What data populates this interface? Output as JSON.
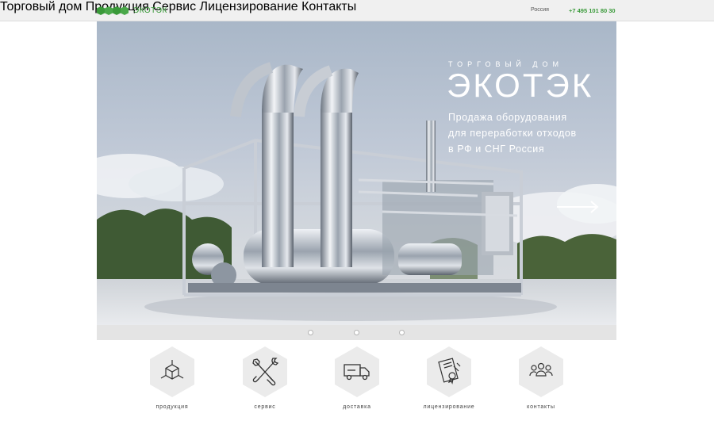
{
  "header": {
    "brand": "ЭКОТЭК",
    "nav": [
      "Торговый дом",
      "Продукция",
      "Сервис",
      "Лицензирование",
      "Контакты"
    ],
    "region": "Россия",
    "phone": "+7 495 101 80 30"
  },
  "hero": {
    "subtitle": "ТОРГОВЫЙ ДОМ",
    "title": "ЭКОТЭК",
    "lines": [
      "Продажа оборудования",
      "для переработки отходов",
      "в РФ и СНГ Россия"
    ]
  },
  "slider": {
    "dots": 3
  },
  "services": [
    {
      "label": "продукция",
      "icon": "cube-icon"
    },
    {
      "label": "сервис",
      "icon": "tools-icon"
    },
    {
      "label": "доставка",
      "icon": "truck-icon"
    },
    {
      "label": "лицензирование",
      "icon": "license-icon"
    },
    {
      "label": "контакты",
      "icon": "people-icon"
    }
  ],
  "colors": {
    "brand_green": "#3a9a3a",
    "header_bg": "#f0f0f0",
    "hex_bg": "#ebebeb"
  }
}
